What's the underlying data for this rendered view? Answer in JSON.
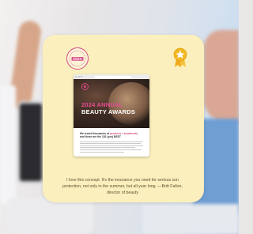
{
  "seal": {
    "year": "2024"
  },
  "browser": {
    "hero_title_line1": "2024 ANNUAL",
    "hero_title_line2": "BEAUTY AWARDS",
    "lead_text_part1": "We tested thousands of ",
    "lead_text_pink": "products + treatments",
    "lead_text_part2": ", and these are the 181 (yes) BEST"
  },
  "quote": {
    "text": "I love this concept. It's the insurance you need for serious sun protection, not only in the summer, but all year long. —Britt Fallon, director of beauty"
  },
  "colors": {
    "card_background": "#fbf0bd",
    "accent_pink": "#ea4b96",
    "medal_gold": "#f2b824"
  }
}
